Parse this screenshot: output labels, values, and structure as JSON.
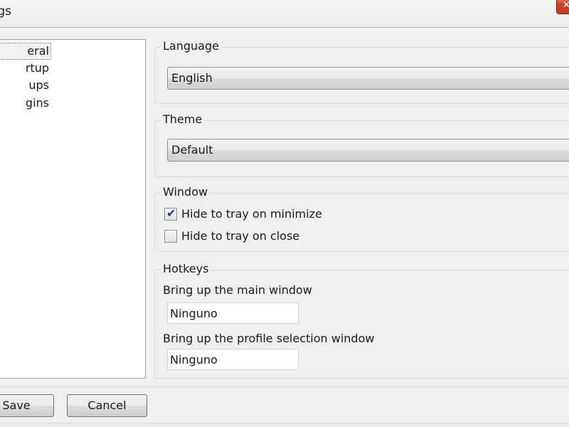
{
  "window": {
    "title_fragment": "gs",
    "close_symbol": "✕"
  },
  "nav": {
    "items": [
      {
        "label": "General",
        "visible": "eral",
        "selected": true
      },
      {
        "label": "Startup",
        "visible": "rtup"
      },
      {
        "label": "Groups",
        "visible": "ups"
      },
      {
        "label": "Plugins",
        "visible": "gins"
      }
    ]
  },
  "language": {
    "title": "Language",
    "value": "English"
  },
  "theme": {
    "title": "Theme",
    "value": "Default"
  },
  "window_group": {
    "title": "Window",
    "hide_on_minimize": {
      "label": "Hide to tray on minimize",
      "checked": true
    },
    "hide_on_close": {
      "label": "Hide to tray on close",
      "checked": false
    }
  },
  "hotkeys": {
    "title": "Hotkeys",
    "main_label": "Bring up the main window",
    "main_value": "Ninguno",
    "profile_label": "Bring up the profile selection window",
    "profile_value": "Ninguno"
  },
  "buttons": {
    "save": "Save",
    "cancel": "Cancel"
  },
  "check_symbol": "✔"
}
